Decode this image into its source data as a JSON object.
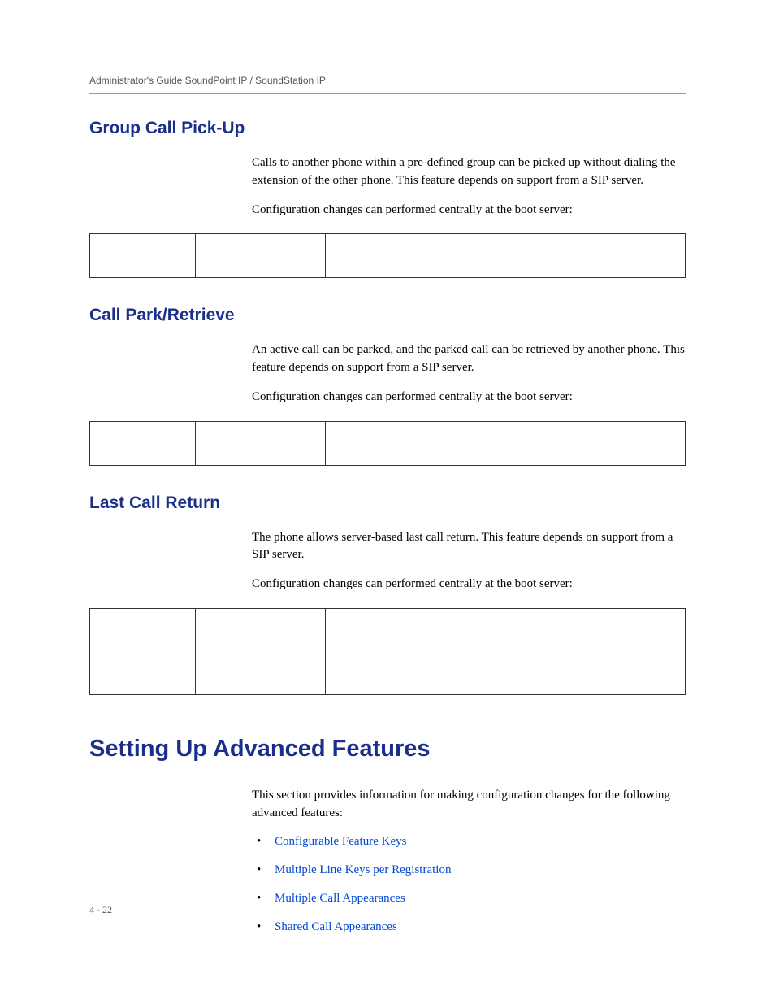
{
  "header": {
    "doc_title": "Administrator's Guide SoundPoint IP / SoundStation IP"
  },
  "sections": {
    "group_call": {
      "heading": "Group Call Pick-Up",
      "p1": "Calls to another phone within a pre-defined group can be picked up without dialing the extension of the other phone. This feature depends on support from a SIP server.",
      "p2": "Configuration changes can performed centrally at the boot server:"
    },
    "call_park": {
      "heading": "Call Park/Retrieve",
      "p1": "An active call can be parked, and the parked call can be retrieved by another phone. This feature depends on support from a SIP server.",
      "p2": "Configuration changes can performed centrally at the boot server:"
    },
    "last_call": {
      "heading": "Last Call Return",
      "p1": "The phone allows server-based last call return. This feature depends on support from a SIP server.",
      "p2": "Configuration changes can performed centrally at the boot server:"
    },
    "advanced": {
      "heading": "Setting Up Advanced Features",
      "intro": "This section provides information for making configuration changes for the following advanced features:",
      "links": {
        "l1": "Configurable Feature Keys",
        "l2": "Multiple Line Keys per Registration",
        "l3": "Multiple Call Appearances",
        "l4": "Shared Call Appearances"
      }
    }
  },
  "footer": {
    "page_num": "4 - 22"
  }
}
